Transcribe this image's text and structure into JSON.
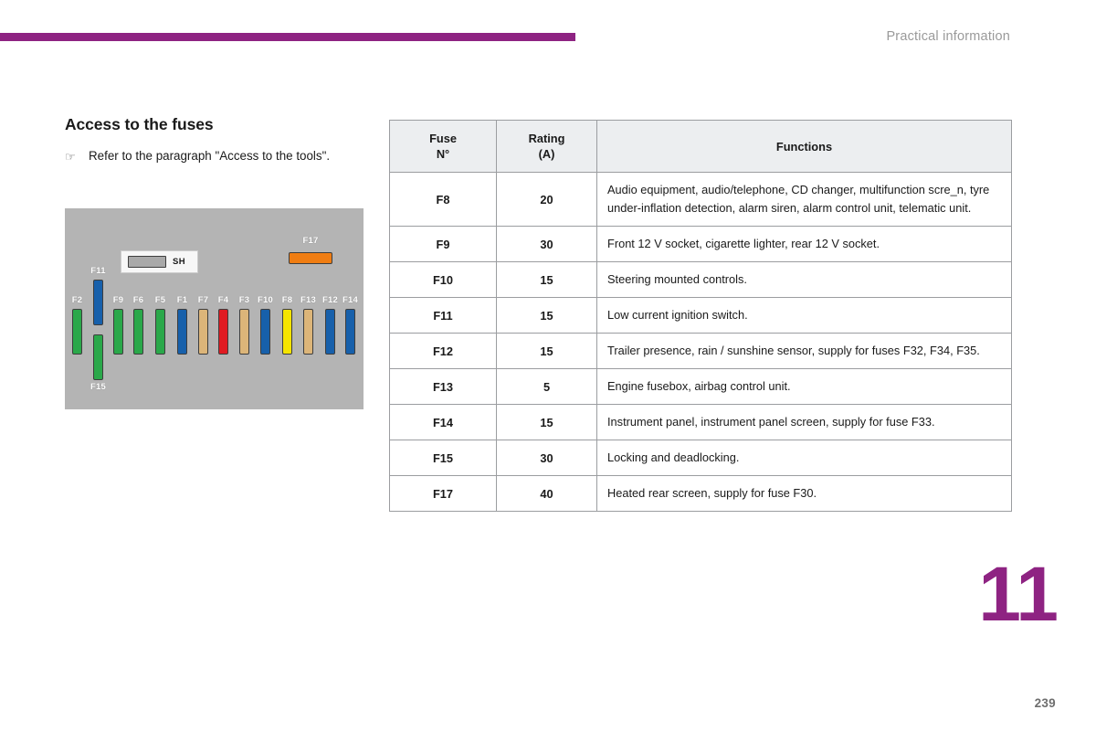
{
  "page": {
    "running_head": "Practical information",
    "chapter_number": "11",
    "page_number": "239",
    "accent_color": "#8e2382"
  },
  "section": {
    "heading": "Access to the fuses",
    "bullet_glyph": "☞",
    "bullet_text": "Refer to the paragraph \"Access to the tools\"."
  },
  "diagram": {
    "background_color": "#b4b4b4",
    "relay": {
      "label": "SH",
      "chip_color": "#a9a9a9"
    },
    "fuses": [
      {
        "label": "F2",
        "color": "#2aa84a",
        "orientation": "vertical"
      },
      {
        "label": "F11",
        "color": "#1760ab",
        "orientation": "vertical"
      },
      {
        "label": "F15",
        "color": "#2aa84a",
        "orientation": "vertical"
      },
      {
        "label": "F9",
        "color": "#2aa84a",
        "orientation": "vertical"
      },
      {
        "label": "F6",
        "color": "#2aa84a",
        "orientation": "vertical"
      },
      {
        "label": "F5",
        "color": "#2aa84a",
        "orientation": "vertical"
      },
      {
        "label": "F1",
        "color": "#1760ab",
        "orientation": "vertical"
      },
      {
        "label": "F7",
        "color": "#dcb579",
        "orientation": "vertical"
      },
      {
        "label": "F4",
        "color": "#e01b22",
        "orientation": "vertical"
      },
      {
        "label": "F3",
        "color": "#dcb579",
        "orientation": "vertical"
      },
      {
        "label": "F10",
        "color": "#1760ab",
        "orientation": "vertical"
      },
      {
        "label": "F8",
        "color": "#f5e400",
        "orientation": "vertical"
      },
      {
        "label": "F13",
        "color": "#dcb579",
        "orientation": "vertical"
      },
      {
        "label": "F12",
        "color": "#1760ab",
        "orientation": "vertical"
      },
      {
        "label": "F14",
        "color": "#1760ab",
        "orientation": "vertical"
      },
      {
        "label": "F17",
        "color": "#f07d12",
        "orientation": "horizontal"
      }
    ]
  },
  "table": {
    "headers": {
      "fuse": "Fuse\nN°",
      "fuse_line1": "Fuse",
      "fuse_line2": "N°",
      "rating_line1": "Rating",
      "rating_line2": "(A)",
      "functions": "Functions"
    },
    "rows": [
      {
        "fuse": "F8",
        "rating": "20",
        "functions": "Audio equipment, audio/telephone, CD changer, multifunction scre_n, tyre under-inflation detection, alarm siren, alarm control unit, telematic unit."
      },
      {
        "fuse": "F9",
        "rating": "30",
        "functions": "Front 12 V socket, cigarette lighter, rear 12 V socket."
      },
      {
        "fuse": "F10",
        "rating": "15",
        "functions": "Steering mounted controls."
      },
      {
        "fuse": "F11",
        "rating": "15",
        "functions": "Low current ignition switch."
      },
      {
        "fuse": "F12",
        "rating": "15",
        "functions": "Trailer presence, rain / sunshine sensor, supply for fuses F32, F34, F35."
      },
      {
        "fuse": "F13",
        "rating": "5",
        "functions": "Engine fusebox, airbag control unit."
      },
      {
        "fuse": "F14",
        "rating": "15",
        "functions": "Instrument panel, instrument panel screen, supply for fuse F33."
      },
      {
        "fuse": "F15",
        "rating": "30",
        "functions": "Locking and deadlocking."
      },
      {
        "fuse": "F17",
        "rating": "40",
        "functions": "Heated rear screen, supply for fuse F30."
      }
    ]
  }
}
